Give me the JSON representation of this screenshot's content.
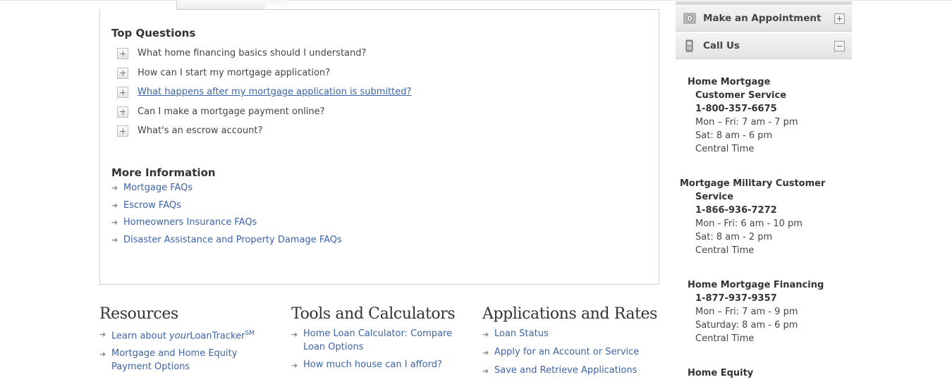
{
  "top_questions": {
    "heading": "Top Questions",
    "items": [
      {
        "label": "What home financing basics should I understand?"
      },
      {
        "label": "How can I start my mortgage application?"
      },
      {
        "label": "What happens after my mortgage application is submitted?"
      },
      {
        "label": "Can I make a mortgage payment online?"
      },
      {
        "label": "What's an escrow account?"
      }
    ]
  },
  "more_info": {
    "heading": "More Information",
    "links": [
      "Mortgage FAQs",
      "Escrow FAQs",
      "Homeowners Insurance FAQs",
      "Disaster Assistance and Property Damage FAQs"
    ]
  },
  "resources": {
    "heading": "Resources",
    "link1_pre": "Learn about ",
    "link1_em": "your",
    "link1_post": "LoanTracker",
    "link1_sup": "SM",
    "link2": "Mortgage and Home Equity Payment Options"
  },
  "tools": {
    "heading": "Tools and Calculators",
    "links": [
      "Home Loan Calculator: Compare Loan Options",
      "How much house can I afford?"
    ]
  },
  "applications": {
    "heading": "Applications and Rates",
    "links": [
      "Loan Status",
      "Apply for an Account or Service",
      "Save and Retrieve Applications"
    ]
  },
  "sidebar": {
    "appointment_label": "Make an Appointment",
    "call_label": "Call Us",
    "contacts": [
      {
        "title1": "Home Mortgage",
        "title2": "Customer Service",
        "phone": "1-800-357-6675",
        "hours1": "Mon – Fri: 7 am - 7 pm",
        "hours2": "Sat: 8 am - 6 pm",
        "tz": "Central Time"
      },
      {
        "title1": "Mortgage Military Customer",
        "title2": "Service",
        "phone": "1-866-936-7272",
        "hours1": "Mon - Fri: 6 am - 10 pm",
        "hours2": "Sat: 8 am - 2 pm",
        "tz": "Central Time"
      },
      {
        "title1": "Home Mortgage Financing",
        "phone": "1-877-937-9357",
        "hours1": "Mon – Fri: 7 am - 9 pm",
        "hours2": "Saturday: 8 am - 6 pm",
        "tz": "Central Time"
      },
      {
        "title1": "Home Equity"
      }
    ]
  },
  "colors": {
    "link": "#3b64a6",
    "text": "#444444"
  }
}
